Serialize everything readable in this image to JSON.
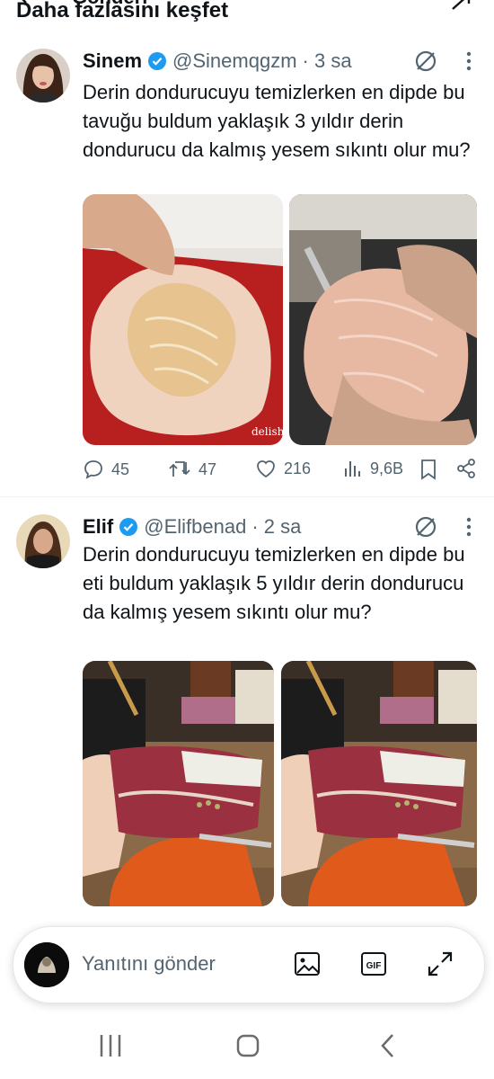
{
  "header": {
    "title": "Daha fazlasını keşfet",
    "cut_text": "Gönderi"
  },
  "tweets": [
    {
      "name": "Sinem",
      "handle": "@Sinemqgzm",
      "time": "· 3 sa",
      "text": "Derin dondurucuyu temizlerken en dipde bu tavuğu  buldum yaklaşık 3 yıldır  derin dondurucu da kalmış yesem sıkıntı olur mu?",
      "media": [
        {
          "alt": "raw chicken breast on red board",
          "watermark": "delish"
        },
        {
          "alt": "hands holding raw chicken under tap"
        }
      ],
      "replies": "45",
      "reposts": "47",
      "likes": "216",
      "views": "9,6B"
    },
    {
      "name": "Elif",
      "handle": "@Elifbenad",
      "time": "· 2 sa",
      "text": "Derin dondurucuyu temizlerken en dipde bu  eti  buldum yaklaşık 5 yıldır  derin dondurucu da kalmış yesem sıkıntı olur mu?",
      "media": [
        {
          "alt": "hand holding raw red meat in kitchen"
        },
        {
          "alt": "hand holding raw red meat in kitchen"
        }
      ]
    }
  ],
  "reply_bar": {
    "placeholder": "Yanıtını gönder",
    "gif_label": "GIF"
  },
  "colors": {
    "verified": "#1d9bf0",
    "text": "#0f1419",
    "secondary": "#536471"
  },
  "icons": [
    "back-icon",
    "verified-badge-icon",
    "grok-icon",
    "more-icon",
    "reply-icon",
    "repost-icon",
    "like-icon",
    "views-icon",
    "bookmark-icon",
    "share-icon",
    "image-icon",
    "gif-icon",
    "expand-icon",
    "recents-icon",
    "home-icon",
    "back-nav-icon"
  ]
}
